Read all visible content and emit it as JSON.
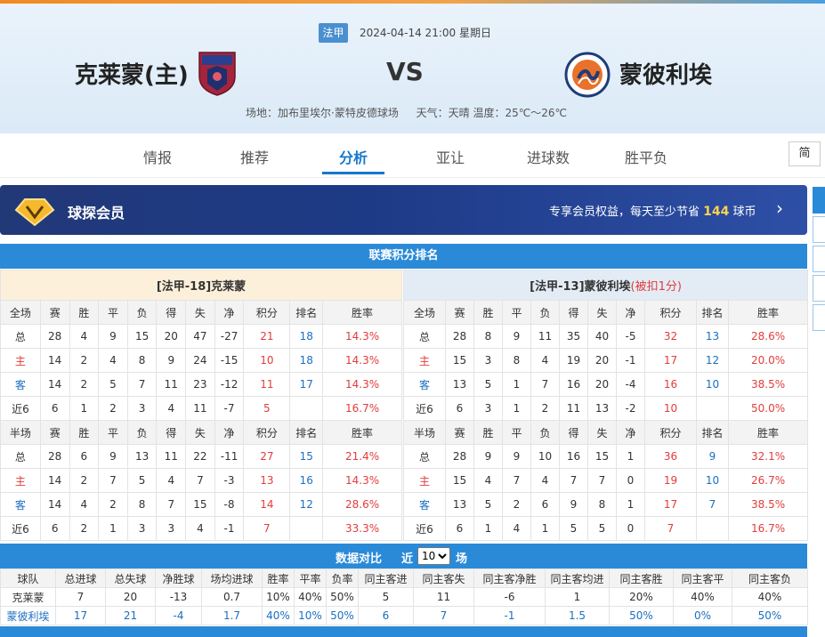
{
  "match": {
    "league": "法甲",
    "datetime": "2024-04-14 21:00 星期日",
    "home": "克莱蒙(主)",
    "vs": "VS",
    "away": "蒙彼利埃",
    "venue": "场地：加布里埃尔·蒙特皮德球场",
    "weather": "天气：天晴 温度：25℃～26℃"
  },
  "tabs": [
    "情报",
    "推荐",
    "分析",
    "亚让",
    "进球数",
    "胜平负"
  ],
  "active_tab": "分析",
  "lang_button": "简",
  "vip": {
    "title": "球探会员",
    "text_prefix": "专享会员权益，每天至少节省",
    "amount": "144",
    "text_suffix": "球币"
  },
  "standings": {
    "title": "联赛积分排名",
    "home_title": "[法甲-18]克莱蒙",
    "away_title": "[法甲-13]蒙彼利埃",
    "away_note": "(被扣1分)",
    "full_header": [
      "全场",
      "赛",
      "胜",
      "平",
      "负",
      "得",
      "失",
      "净",
      "积分",
      "排名",
      "胜率"
    ],
    "half_header": [
      "半场",
      "赛",
      "胜",
      "平",
      "负",
      "得",
      "失",
      "净",
      "积分",
      "排名",
      "胜率"
    ],
    "home_full": [
      [
        "总",
        "28",
        "4",
        "9",
        "15",
        "20",
        "47",
        "-27",
        "21",
        "18",
        "14.3%"
      ],
      [
        "主",
        "14",
        "2",
        "4",
        "8",
        "9",
        "24",
        "-15",
        "10",
        "18",
        "14.3%"
      ],
      [
        "客",
        "14",
        "2",
        "5",
        "7",
        "11",
        "23",
        "-12",
        "11",
        "17",
        "14.3%"
      ],
      [
        "近6",
        "6",
        "1",
        "2",
        "3",
        "4",
        "11",
        "-7",
        "5",
        "",
        "16.7%"
      ]
    ],
    "away_full": [
      [
        "总",
        "28",
        "8",
        "9",
        "11",
        "35",
        "40",
        "-5",
        "32",
        "13",
        "28.6%"
      ],
      [
        "主",
        "15",
        "3",
        "8",
        "4",
        "19",
        "20",
        "-1",
        "17",
        "12",
        "20.0%"
      ],
      [
        "客",
        "13",
        "5",
        "1",
        "7",
        "16",
        "20",
        "-4",
        "16",
        "10",
        "38.5%"
      ],
      [
        "近6",
        "6",
        "3",
        "1",
        "2",
        "11",
        "13",
        "-2",
        "10",
        "",
        "50.0%"
      ]
    ],
    "home_half": [
      [
        "总",
        "28",
        "6",
        "9",
        "13",
        "11",
        "22",
        "-11",
        "27",
        "15",
        "21.4%"
      ],
      [
        "主",
        "14",
        "2",
        "7",
        "5",
        "4",
        "7",
        "-3",
        "13",
        "16",
        "14.3%"
      ],
      [
        "客",
        "14",
        "4",
        "2",
        "8",
        "7",
        "15",
        "-8",
        "14",
        "12",
        "28.6%"
      ],
      [
        "近6",
        "6",
        "2",
        "1",
        "3",
        "3",
        "4",
        "-1",
        "7",
        "",
        "33.3%"
      ]
    ],
    "away_half": [
      [
        "总",
        "28",
        "9",
        "9",
        "10",
        "16",
        "15",
        "1",
        "36",
        "9",
        "32.1%"
      ],
      [
        "主",
        "15",
        "4",
        "7",
        "4",
        "7",
        "7",
        "0",
        "19",
        "10",
        "26.7%"
      ],
      [
        "客",
        "13",
        "5",
        "2",
        "6",
        "9",
        "8",
        "1",
        "17",
        "7",
        "38.5%"
      ],
      [
        "近6",
        "6",
        "1",
        "4",
        "1",
        "5",
        "5",
        "0",
        "7",
        "",
        "16.7%"
      ]
    ]
  },
  "compare": {
    "title": "数据对比",
    "near_label": "近",
    "select_value": "10",
    "field_label": "场",
    "header": [
      "球队",
      "总进球",
      "总失球",
      "净胜球",
      "场均进球",
      "胜率",
      "平率",
      "负率",
      "同主客进",
      "同主客失",
      "同主客净胜",
      "同主客均进",
      "同主客胜",
      "同主客平",
      "同主客负"
    ],
    "rows": [
      [
        "克莱蒙",
        "7",
        "20",
        "-13",
        "0.7",
        "10%",
        "40%",
        "50%",
        "5",
        "11",
        "-6",
        "1",
        "20%",
        "40%",
        "40%"
      ],
      [
        "蒙彼利埃",
        "17",
        "21",
        "-4",
        "1.7",
        "40%",
        "10%",
        "50%",
        "6",
        "7",
        "-1",
        "1.5",
        "50%",
        "0%",
        "50%"
      ]
    ]
  }
}
